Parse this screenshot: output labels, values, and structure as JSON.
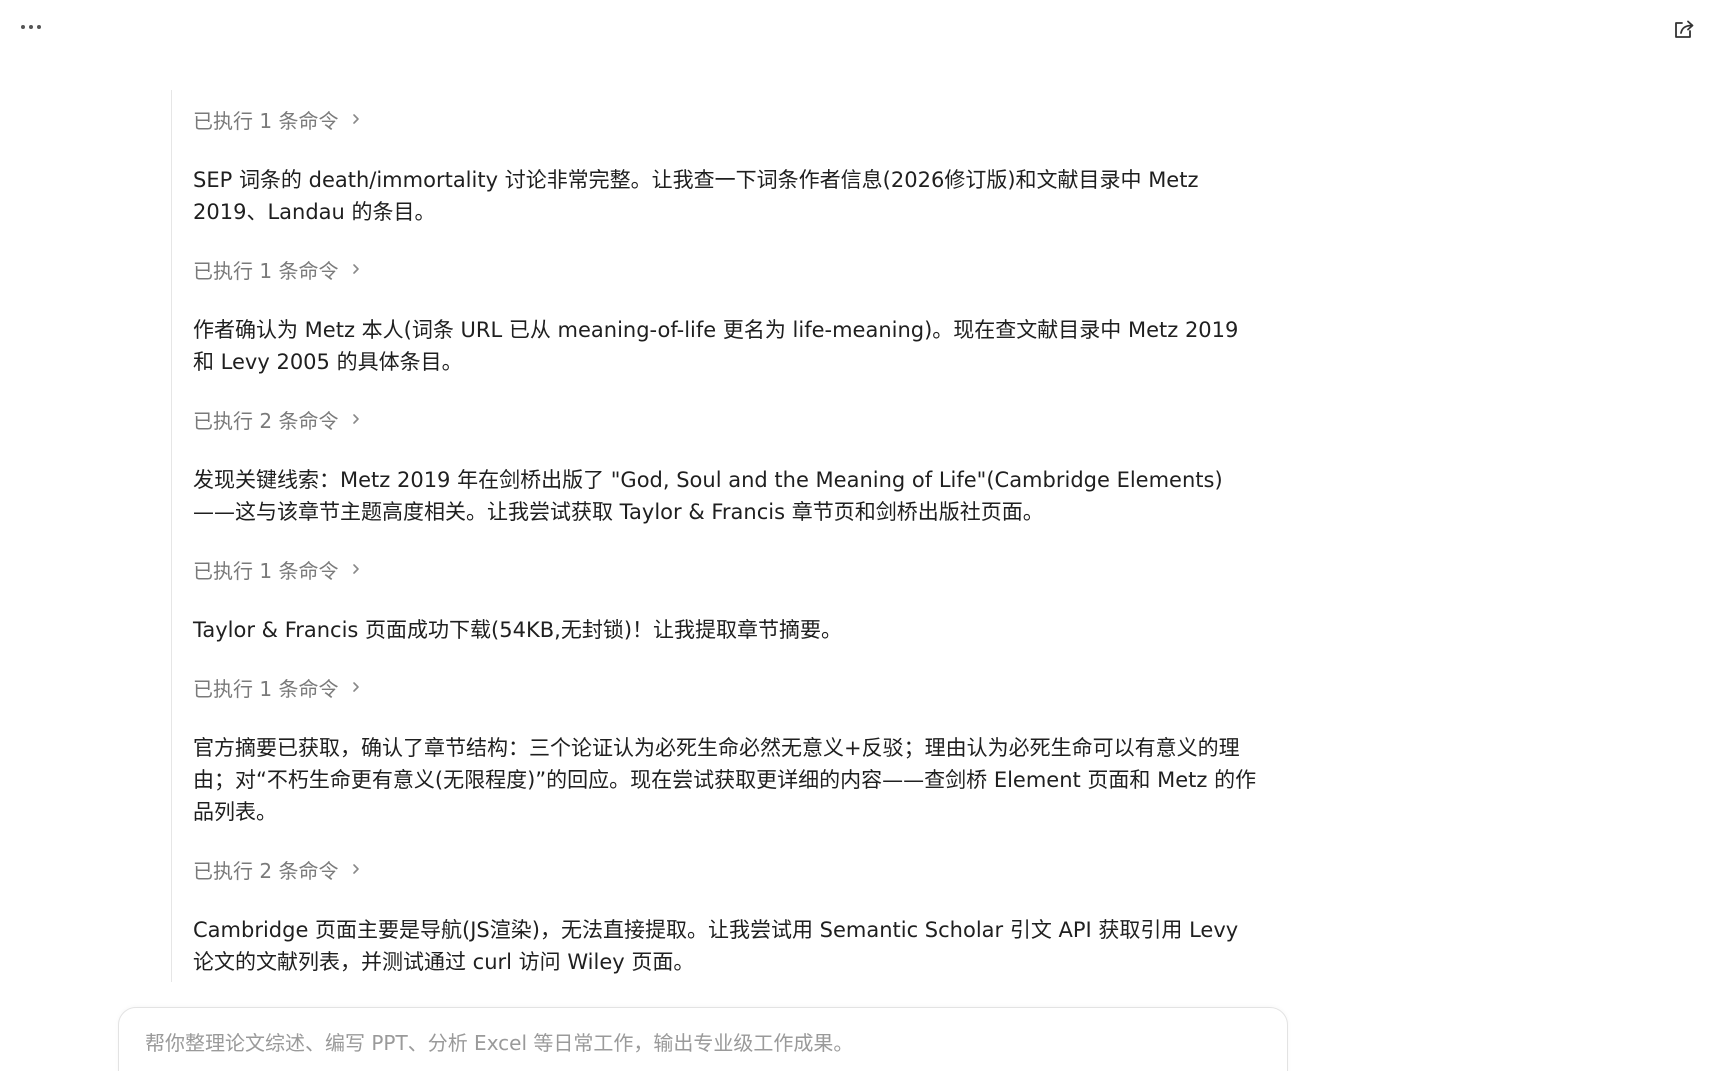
{
  "header": {
    "more_icon": "more-horizontal-icon",
    "share_icon": "share-icon"
  },
  "thread": {
    "entries": [
      {
        "cmd_label": "已执行 1 条命令",
        "message": "SEP 词条的 death/immortality 讨论非常完整。让我查一下词条作者信息(2026修订版)和文献目录中 Metz 2019、Landau 的条目。"
      },
      {
        "cmd_label": "已执行 1 条命令",
        "message": "作者确认为 Metz 本人(词条 URL 已从 meaning-of-life 更名为 life-meaning)。现在查文献目录中 Metz 2019 和 Levy 2005 的具体条目。"
      },
      {
        "cmd_label": "已执行 2 条命令",
        "message": "发现关键线索：Metz 2019 年在剑桥出版了 \"God, Soul and the Meaning of Life\"(Cambridge Elements)——这与该章节主题高度相关。让我尝试获取 Taylor & Francis 章节页和剑桥出版社页面。"
      },
      {
        "cmd_label": "已执行 1 条命令",
        "message": "Taylor & Francis 页面成功下载(54KB,无封锁)！让我提取章节摘要。"
      },
      {
        "cmd_label": "已执行 1 条命令",
        "message": "官方摘要已获取，确认了章节结构：三个论证认为必死生命必然无意义+反驳；理由认为必死生命可以有意义的理由；对“不朽生命更有意义(无限程度)”的回应。现在尝试获取更详细的内容——查剑桥 Element 页面和 Metz 的作品列表。"
      },
      {
        "cmd_label": "已执行 2 条命令",
        "message": "Cambridge 页面主要是导航(JS渲染)，无法直接提取。让我尝试用 Semantic Scholar 引文 API 获取引用 Levy 论文的文献列表，并测试通过 curl 访问 Wiley 页面。"
      }
    ]
  },
  "composer": {
    "placeholder": "帮你整理论文综述、编写 PPT、分析 Excel 等日常工作，输出专业级工作成果。",
    "value": ""
  }
}
